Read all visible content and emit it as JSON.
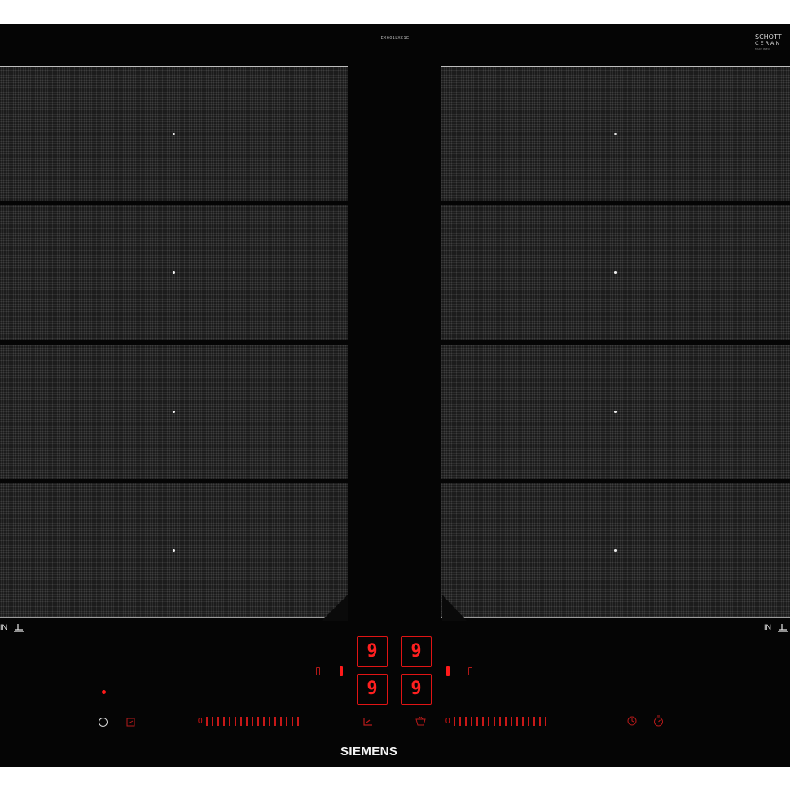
{
  "header": {
    "model_code": "EX601LXC1E",
    "glass_brand_line1": "SCHOTT",
    "glass_brand_line2": "CERAN",
    "glass_brand_line3": "MADE IN EU"
  },
  "zones": [
    {
      "side": "left",
      "index": 1
    },
    {
      "side": "left",
      "index": 2
    },
    {
      "side": "left",
      "index": 3
    },
    {
      "side": "left",
      "index": 4
    },
    {
      "side": "right",
      "index": 1
    },
    {
      "side": "right",
      "index": 2
    },
    {
      "side": "right",
      "index": 3
    },
    {
      "side": "right",
      "index": 4
    }
  ],
  "labels": {
    "left_in": "IN",
    "right_in": "IN",
    "pot_icon": "⫰"
  },
  "displays": {
    "top_left": "9",
    "top_right": "9",
    "bottom_left": "9",
    "bottom_right": "9"
  },
  "controls": {
    "power_icon": "power-icon",
    "childlock_icon": "lock-icon",
    "slider_zero_left": "0",
    "slider_zero_right": "0",
    "wipe_icon": "wipe-protection-icon",
    "basket_icon": "basket-icon",
    "timer_icon": "timer-icon",
    "stopwatch_icon": "stopwatch-icon",
    "slider_levels": 17
  },
  "brand": "SIEMENS",
  "colors": {
    "glass": "#050505",
    "zone": "#1c1c1c",
    "led_red": "#ff1a1a"
  }
}
